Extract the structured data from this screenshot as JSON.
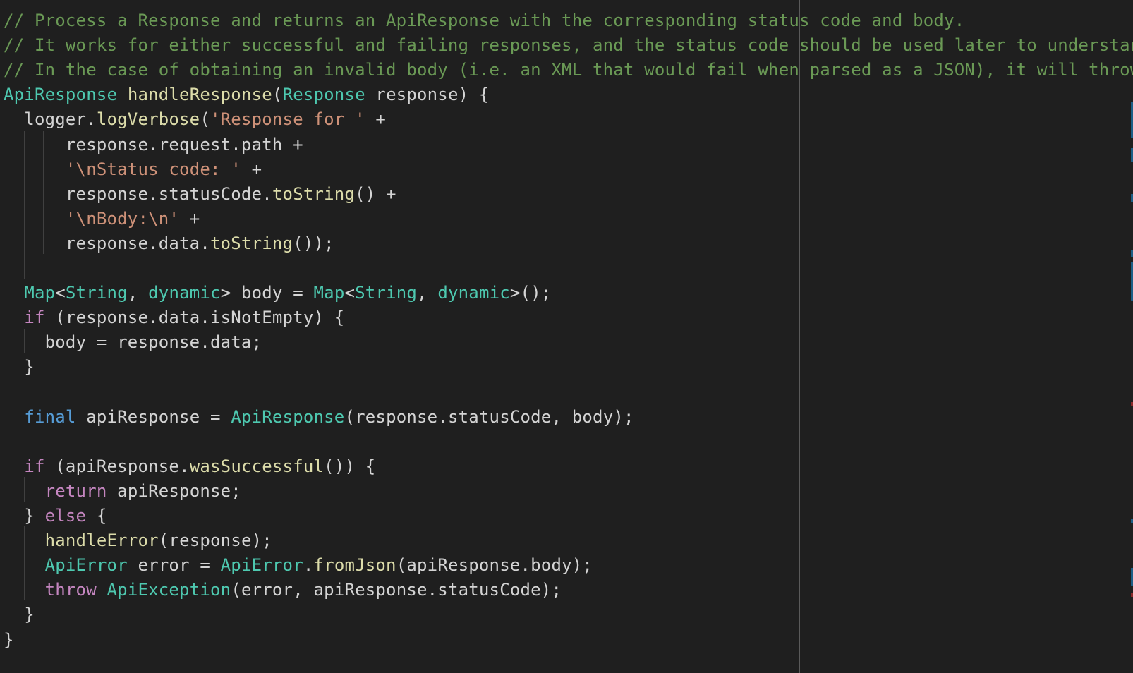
{
  "editor": {
    "colors": {
      "background": "#1f1f1f",
      "comment": "#6a9955",
      "type": "#4ec9b0",
      "function": "#dcdcaa",
      "string": "#ce9178",
      "keyword": "#569cd6",
      "control": "#c586c0",
      "text": "#d4d4d4"
    },
    "lines": [
      [
        [
          "comment",
          "// Process a Response and returns an ApiResponse with the corresponding status code and body."
        ]
      ],
      [
        [
          "comment",
          "// It works for either successful and failing responses, and the status code should be used later to understand"
        ]
      ],
      [
        [
          "comment",
          "// In the case of obtaining an invalid body (i.e. an XML that would fail when parsed as a JSON), it will throw"
        ]
      ],
      [
        [
          "type",
          "ApiResponse"
        ],
        [
          "plain",
          " "
        ],
        [
          "func",
          "handleResponse"
        ],
        [
          "punct",
          "("
        ],
        [
          "type",
          "Response"
        ],
        [
          "plain",
          " response) {"
        ]
      ],
      [
        [
          "plain",
          "  logger."
        ],
        [
          "func",
          "logVerbose"
        ],
        [
          "punct",
          "("
        ],
        [
          "string",
          "'Response for '"
        ],
        [
          "plain",
          " +"
        ]
      ],
      [
        [
          "plain",
          "      response.request.path +"
        ]
      ],
      [
        [
          "plain",
          "      "
        ],
        [
          "string",
          "'\\nStatus code: '"
        ],
        [
          "plain",
          " +"
        ]
      ],
      [
        [
          "plain",
          "      response.statusCode."
        ],
        [
          "func",
          "toString"
        ],
        [
          "plain",
          "() +"
        ]
      ],
      [
        [
          "plain",
          "      "
        ],
        [
          "string",
          "'\\nBody:\\n'"
        ],
        [
          "plain",
          " +"
        ]
      ],
      [
        [
          "plain",
          "      response.data."
        ],
        [
          "func",
          "toString"
        ],
        [
          "plain",
          "());"
        ]
      ],
      [
        [
          "plain",
          ""
        ]
      ],
      [
        [
          "plain",
          "  "
        ],
        [
          "type",
          "Map"
        ],
        [
          "punct",
          "<"
        ],
        [
          "type",
          "String"
        ],
        [
          "punct",
          ", "
        ],
        [
          "type",
          "dynamic"
        ],
        [
          "plain",
          "> body = "
        ],
        [
          "type",
          "Map"
        ],
        [
          "punct",
          "<"
        ],
        [
          "type",
          "String"
        ],
        [
          "punct",
          ", "
        ],
        [
          "type",
          "dynamic"
        ],
        [
          "plain",
          ">();"
        ]
      ],
      [
        [
          "plain",
          "  "
        ],
        [
          "control",
          "if"
        ],
        [
          "plain",
          " (response.data.isNotEmpty) {"
        ]
      ],
      [
        [
          "plain",
          "    body = response.data;"
        ]
      ],
      [
        [
          "plain",
          "  }"
        ]
      ],
      [
        [
          "plain",
          ""
        ]
      ],
      [
        [
          "plain",
          "  "
        ],
        [
          "keyword",
          "final"
        ],
        [
          "plain",
          " apiResponse = "
        ],
        [
          "type",
          "ApiResponse"
        ],
        [
          "plain",
          "(response.statusCode, body);"
        ]
      ],
      [
        [
          "plain",
          ""
        ]
      ],
      [
        [
          "plain",
          "  "
        ],
        [
          "control",
          "if"
        ],
        [
          "plain",
          " (apiResponse."
        ],
        [
          "func",
          "wasSuccessful"
        ],
        [
          "plain",
          "()) {"
        ]
      ],
      [
        [
          "plain",
          "    "
        ],
        [
          "control",
          "return"
        ],
        [
          "plain",
          " apiResponse;"
        ]
      ],
      [
        [
          "plain",
          "  } "
        ],
        [
          "control",
          "else"
        ],
        [
          "plain",
          " {"
        ]
      ],
      [
        [
          "plain",
          "    "
        ],
        [
          "func",
          "handleError"
        ],
        [
          "plain",
          "(response);"
        ]
      ],
      [
        [
          "plain",
          "    "
        ],
        [
          "type",
          "ApiError"
        ],
        [
          "plain",
          " error = "
        ],
        [
          "type",
          "ApiError"
        ],
        [
          "plain",
          "."
        ],
        [
          "func",
          "fromJson"
        ],
        [
          "plain",
          "(apiResponse.body);"
        ]
      ],
      [
        [
          "plain",
          "    "
        ],
        [
          "control",
          "throw"
        ],
        [
          "plain",
          " "
        ],
        [
          "type",
          "ApiException"
        ],
        [
          "plain",
          "(error, apiResponse.statusCode);"
        ]
      ],
      [
        [
          "plain",
          "  }"
        ]
      ],
      [
        [
          "plain",
          "}"
        ]
      ]
    ]
  }
}
